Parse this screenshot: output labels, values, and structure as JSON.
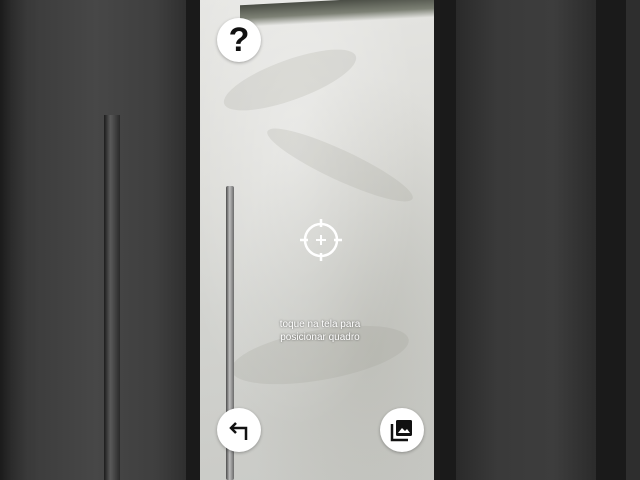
{
  "help": {
    "label": "?"
  },
  "hint": {
    "line1": "toque na tela para",
    "line2": "posicionar quadro"
  },
  "icons": {
    "help": "question-mark-icon",
    "back": "back-arrow-icon",
    "gallery": "photo-library-icon",
    "reticle": "crosshair-icon"
  },
  "colors": {
    "button_bg": "#ffffff",
    "icon": "#111111",
    "text": "#ffffff"
  }
}
